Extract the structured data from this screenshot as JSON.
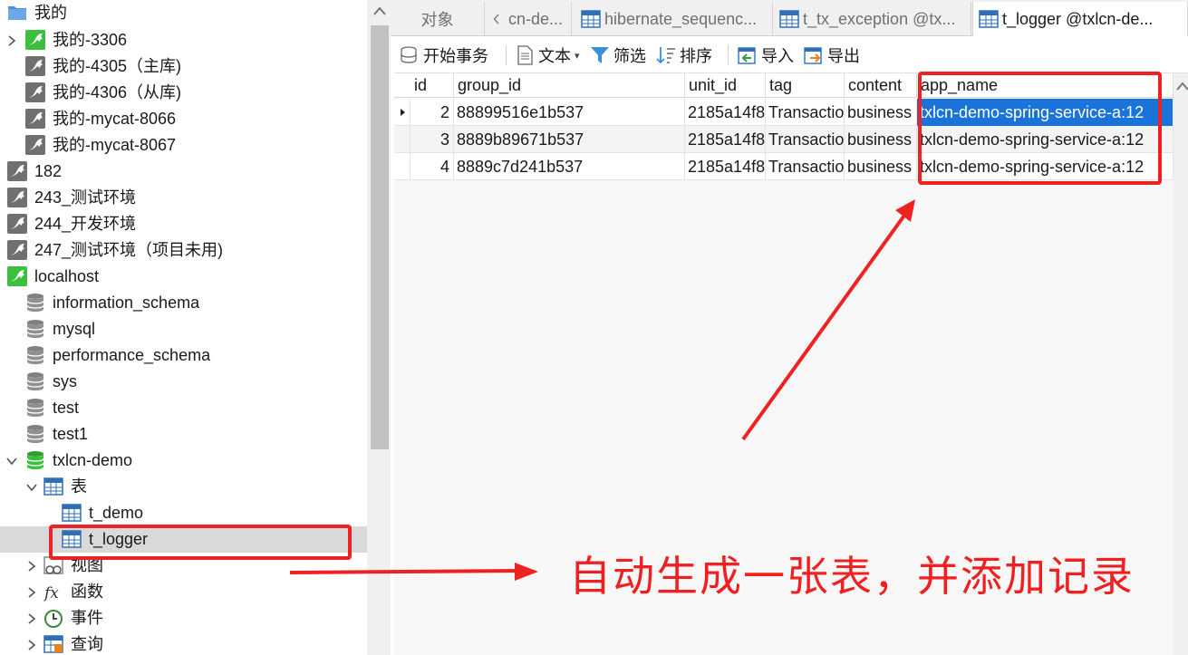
{
  "tree": {
    "items": [
      {
        "label": "我的",
        "icon": "folder-icon"
      },
      {
        "label": "我的-3306",
        "icon": "mysql-connection-icon"
      },
      {
        "label": "我的-4305（主库)",
        "icon": "mysql-connection-icon"
      },
      {
        "label": "我的-4306（从库)",
        "icon": "mysql-connection-icon"
      },
      {
        "label": "我的-mycat-8066",
        "icon": "mysql-connection-icon"
      },
      {
        "label": "我的-mycat-8067",
        "icon": "mysql-connection-icon"
      },
      {
        "label": "182",
        "icon": "mysql-connection-icon"
      },
      {
        "label": "243_测试环境",
        "icon": "mysql-connection-icon"
      },
      {
        "label": "244_开发环境",
        "icon": "mysql-connection-icon"
      },
      {
        "label": "247_测试环境（项目未用)",
        "icon": "mysql-connection-icon"
      },
      {
        "label": "localhost",
        "icon": "mysql-connection-icon"
      },
      {
        "label": "information_schema",
        "icon": "database-icon"
      },
      {
        "label": "mysql",
        "icon": "database-icon"
      },
      {
        "label": "performance_schema",
        "icon": "database-icon"
      },
      {
        "label": "sys",
        "icon": "database-icon"
      },
      {
        "label": "test",
        "icon": "database-icon"
      },
      {
        "label": "test1",
        "icon": "database-icon"
      },
      {
        "label": "txlcn-demo",
        "icon": "database-icon"
      },
      {
        "label": "表",
        "icon": "tables-folder-icon"
      },
      {
        "label": "t_demo",
        "icon": "table-icon"
      },
      {
        "label": "t_logger",
        "icon": "table-icon"
      },
      {
        "label": "视图",
        "icon": "views-icon"
      },
      {
        "label": "函数",
        "icon": "function-icon"
      },
      {
        "label": "事件",
        "icon": "event-icon"
      },
      {
        "label": "查询",
        "icon": "query-icon"
      }
    ]
  },
  "tabs": [
    {
      "label": "对象"
    },
    {
      "label": "cn-de..."
    },
    {
      "label": "hibernate_sequenc..."
    },
    {
      "label": "t_tx_exception @tx..."
    },
    {
      "label": "t_logger @txlcn-de..."
    }
  ],
  "toolbar": {
    "begin_transaction": "开始事务",
    "text": "文本",
    "filter": "筛选",
    "sort": "排序",
    "import": "导入",
    "export": "导出"
  },
  "grid": {
    "columns": [
      "id",
      "group_id",
      "unit_id",
      "tag",
      "content",
      "app_name"
    ],
    "rows": [
      [
        "2",
        "88899516e1b537",
        "2185a14f8",
        "Transactio",
        "business",
        "txlcn-demo-spring-service-a:12"
      ],
      [
        "3",
        "8889b89671b537",
        "2185a14f8",
        "Transactio",
        "business",
        "txlcn-demo-spring-service-a:12"
      ],
      [
        "4",
        "8889c7d241b537",
        "2185a14f8",
        "Transactio",
        "business",
        "txlcn-demo-spring-service-a:12"
      ]
    ]
  },
  "annotation": {
    "text": "自动生成一张表，并添加记录",
    "color": "#f02020"
  },
  "colors": {
    "selection": "#1a73d9",
    "mysql_green": "#3cbf3c",
    "annotation_red": "#ee2222"
  }
}
